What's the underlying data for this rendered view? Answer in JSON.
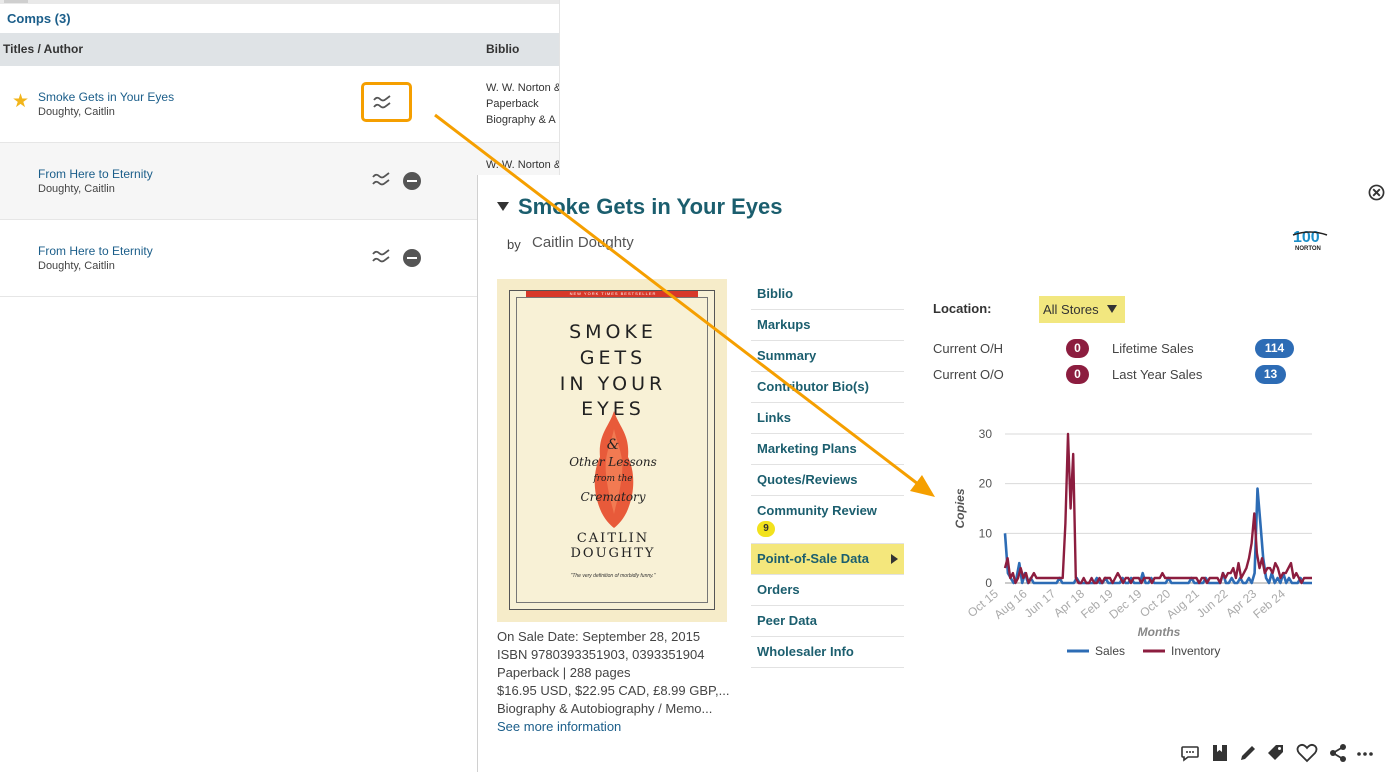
{
  "comps": {
    "title": "Comps (3)",
    "col_titles": "Titles / Author",
    "col_biblio": "Biblio",
    "rows": [
      {
        "title": "Smoke Gets in Your Eyes",
        "author": "Doughty, Caitlin",
        "biblio": [
          "W. W. Norton &",
          "Paperback",
          "Biography & A"
        ]
      },
      {
        "title": "From Here to Eternity",
        "author": "Doughty, Caitlin",
        "biblio": [
          "W. W. Norton &"
        ]
      },
      {
        "title": "From Here to Eternity",
        "author": "Doughty, Caitlin",
        "biblio": []
      }
    ]
  },
  "detail": {
    "title": "Smoke Gets in Your Eyes",
    "by": "by",
    "author": "Caitlin Doughty",
    "publisher_logo": "100 NORTON",
    "cover": {
      "banner": "NEW YORK TIMES BESTSELLER",
      "title_lines": [
        "SMOKE",
        "GETS",
        "IN YOUR",
        "EYES"
      ],
      "amp": "&",
      "subtitle_lines": [
        "Other Lessons",
        "from the",
        "Crematory"
      ],
      "author_lines": [
        "CAITLIN",
        "DOUGHTY"
      ],
      "quote": "\"The very definition of morbidly funny.\""
    },
    "meta": {
      "on_sale": "On Sale Date: September 28, 2015",
      "isbn": "ISBN 9780393351903, 0393351904",
      "format": "Paperback | 288 pages",
      "price": "$16.95 USD, $22.95 CAD, £8.99 GBP,...",
      "category": "Biography & Autobiography / Memo...",
      "more": "See more information"
    },
    "nav": {
      "biblio": "Biblio",
      "markups": "Markups",
      "summary": "Summary",
      "contributor": "Contributor Bio(s)",
      "links": "Links",
      "marketing": "Marketing Plans",
      "quotes": "Quotes/Reviews",
      "community": "Community Review",
      "community_count": "9",
      "pos": "Point-of-Sale Data",
      "orders": "Orders",
      "peer": "Peer Data",
      "wholesaler": "Wholesaler Info"
    },
    "location_label": "Location:",
    "location_value": "All Stores",
    "stats": {
      "current_oh_label": "Current O/H",
      "current_oh": "0",
      "current_oo_label": "Current O/O",
      "current_oo": "0",
      "lifetime_label": "Lifetime Sales",
      "lifetime": "114",
      "lastyear_label": "Last Year Sales",
      "lastyear": "13"
    }
  },
  "colors": {
    "sales": "#2d6cb5",
    "inventory": "#8c1d3f",
    "accent": "#f59f00",
    "highlight": "#f2e77f"
  },
  "chart_data": {
    "type": "line",
    "ylabel": "Copies",
    "xlabel": "Months",
    "ylim": [
      0,
      30
    ],
    "yticks": [
      0,
      10,
      20,
      30
    ],
    "xtick_labels": [
      "Oct 15",
      "Aug 16",
      "Jun 17",
      "Apr 18",
      "Feb 19",
      "Dec 19",
      "Oct 20",
      "Aug 21",
      "Jun 22",
      "Apr 23",
      "Feb 24"
    ],
    "legend": [
      "Sales",
      "Inventory"
    ],
    "series": [
      {
        "name": "Sales",
        "values": [
          10,
          2,
          1,
          0,
          1,
          4,
          0,
          2,
          0,
          1,
          0,
          0,
          0,
          0,
          0,
          0,
          0,
          0,
          0,
          1,
          0,
          0,
          0,
          0,
          0,
          1,
          0,
          0,
          0,
          0,
          0,
          0,
          1,
          0,
          0,
          1,
          0,
          0,
          0,
          0,
          0,
          1,
          0,
          0,
          1,
          0,
          0,
          0,
          2,
          0,
          0,
          1,
          0,
          0,
          0,
          0,
          0,
          1,
          0,
          0,
          0,
          0,
          0,
          0,
          0,
          1,
          0,
          0,
          0,
          0,
          1,
          0,
          0,
          0,
          0,
          0,
          2,
          0,
          0,
          1,
          0,
          0,
          1,
          0,
          0,
          1,
          0,
          2,
          19,
          12,
          5,
          1,
          0,
          2,
          0,
          1,
          0,
          2,
          0,
          1,
          0,
          0,
          0,
          1,
          0,
          0,
          0,
          0
        ]
      },
      {
        "name": "Inventory",
        "values": [
          3,
          5,
          1,
          2,
          0,
          1,
          3,
          1,
          2,
          0,
          1,
          2,
          1,
          1,
          1,
          1,
          1,
          1,
          1,
          1,
          1,
          1,
          1,
          12,
          30,
          15,
          26,
          1,
          0,
          0,
          1,
          0,
          0,
          1,
          0,
          0,
          1,
          0,
          1,
          1,
          1,
          0,
          1,
          2,
          1,
          0,
          1,
          1,
          0,
          1,
          1,
          1,
          0,
          1,
          1,
          1,
          0,
          1,
          1,
          1,
          2,
          1,
          1,
          1,
          1,
          1,
          1,
          1,
          1,
          1,
          1,
          1,
          1,
          1,
          0,
          1,
          1,
          0,
          1,
          1,
          1,
          1,
          0,
          2,
          1,
          2,
          2,
          3,
          1,
          4,
          1,
          2,
          3,
          5,
          8,
          14,
          6,
          3,
          5,
          2,
          3,
          3,
          2,
          4,
          3,
          1,
          2,
          2,
          3,
          4,
          1,
          2,
          1,
          0,
          1,
          1,
          1,
          1
        ]
      }
    ]
  },
  "toolbar": [
    "comment-icon",
    "bookmark-icon",
    "edit-icon",
    "tag-icon",
    "heart-icon",
    "share-icon",
    "more-icon"
  ]
}
